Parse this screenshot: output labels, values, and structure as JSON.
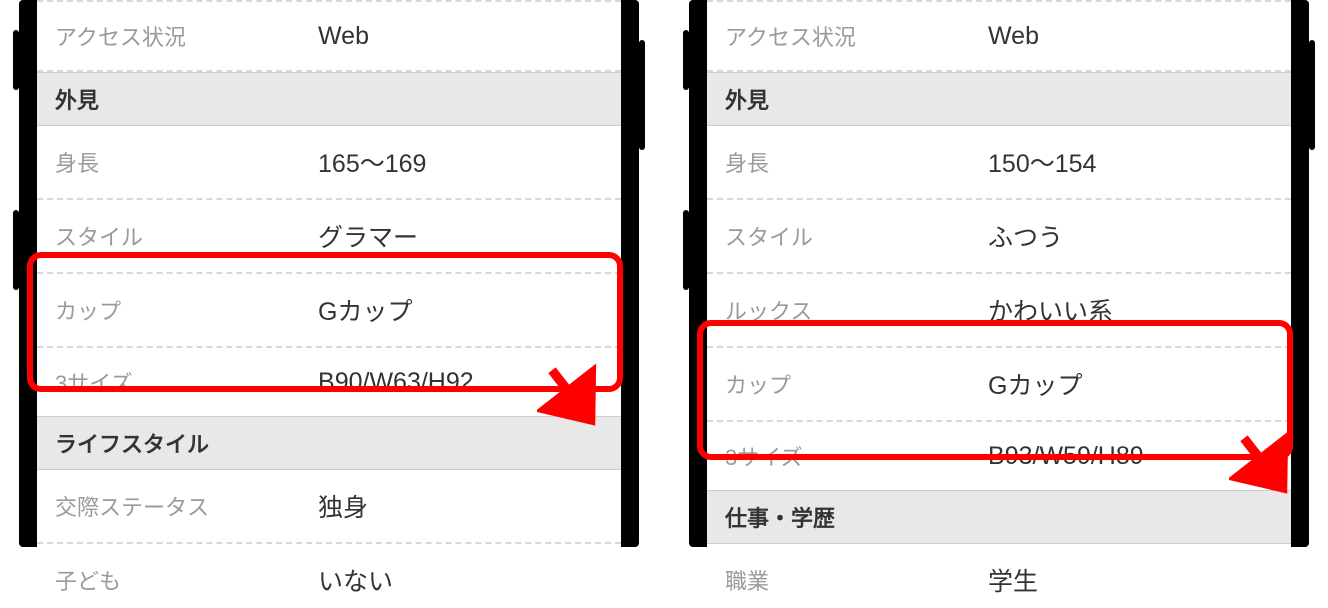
{
  "phones": [
    {
      "rows_top": [
        {
          "label": "アクセス状況",
          "value": "Web"
        }
      ],
      "section1": "外見",
      "rows_mid": [
        {
          "label": "身長",
          "value": "165〜169"
        },
        {
          "label": "スタイル",
          "value": "グラマー"
        },
        {
          "label": "カップ",
          "value": "Gカップ"
        },
        {
          "label": "3サイズ",
          "value": "B90/W63/H92"
        }
      ],
      "section2": "ライフスタイル",
      "rows_bot": [
        {
          "label": "交際ステータス",
          "value": "独身"
        },
        {
          "label": "子ども",
          "value": "いない"
        }
      ]
    },
    {
      "rows_top": [
        {
          "label": "アクセス状況",
          "value": "Web"
        }
      ],
      "section1": "外見",
      "rows_mid": [
        {
          "label": "身長",
          "value": "150〜154"
        },
        {
          "label": "スタイル",
          "value": "ふつう"
        },
        {
          "label": "ルックス",
          "value": "かわいい系"
        },
        {
          "label": "カップ",
          "value": "Gカップ"
        },
        {
          "label": "3サイズ",
          "value": "B93/W59/H89"
        }
      ],
      "section2": "仕事・学歴",
      "rows_bot": [
        {
          "label": "職業",
          "value": "学生"
        }
      ]
    }
  ]
}
